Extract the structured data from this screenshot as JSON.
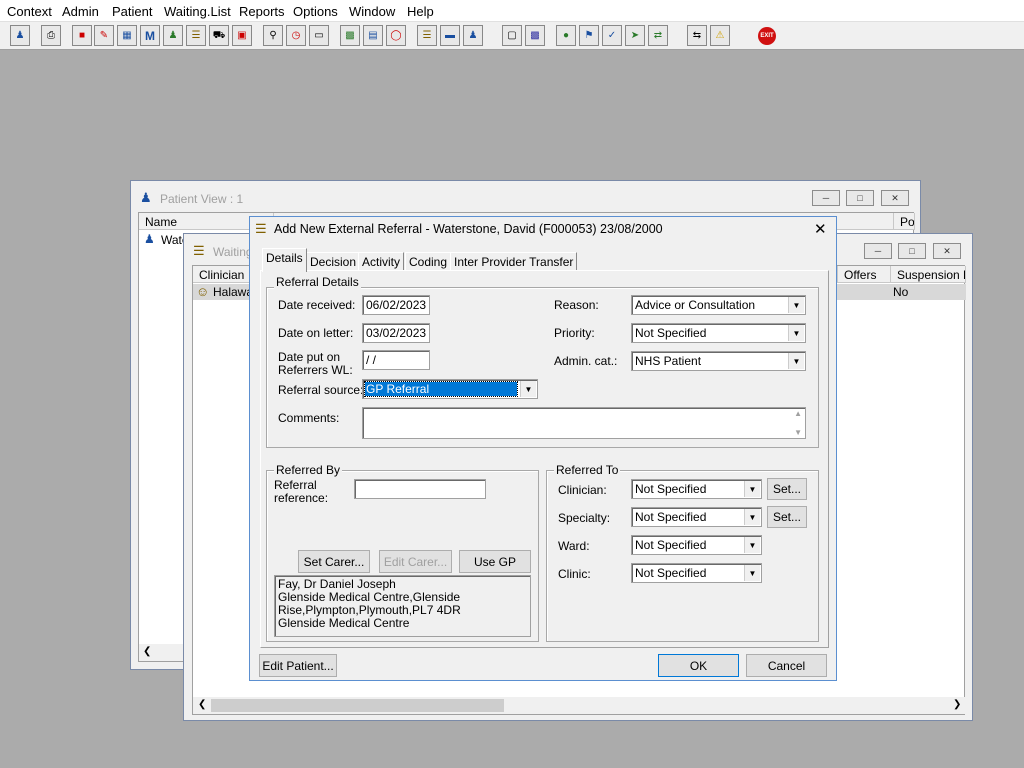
{
  "menu": [
    "Context",
    "Admin",
    "Patient",
    "Waiting.List",
    "Reports",
    "Options",
    "Window",
    "Help"
  ],
  "toolbar_icons": [
    "user-icon",
    "printer-icon",
    "book-red-icon",
    "book-edit-icon",
    "patient-card-icon",
    "m-icon",
    "doctor-icon",
    "notepad-icon",
    "ambulance-icon",
    "car-icon",
    "magnifier-icon",
    "clock-icon",
    "monitor-icon",
    "id-card-icon",
    "list-card-icon",
    "compass-icon",
    "notes-icon",
    "bed-icon",
    "nurse-icon",
    "document-icon",
    "bar-chart-icon",
    "globe-icon",
    "flag-icon",
    "check-card-icon",
    "green-arrow-card-icon",
    "green-arrows-card-icon",
    "swap-arrows-icon",
    "warning-icon",
    "exit-icon"
  ],
  "patient_view": {
    "title": "Patient View : 1",
    "col_name": "Name",
    "col_po": "Po",
    "row_name": "Wate"
  },
  "waiting": {
    "title": "Waiting",
    "col_clinician": "Clinician",
    "col_offers": "Offers",
    "col_suspension": "Suspension Pe",
    "row_clinician": "Halawa",
    "row_suspension": "No"
  },
  "dialog": {
    "title": "Add New External Referral - Waterstone, David (F000053) 23/08/2000",
    "tabs": [
      "Details",
      "Decision",
      "Activity",
      "Coding",
      "Inter Provider Transfer"
    ],
    "referral_details": {
      "label": "Referral Details",
      "date_received_label": "Date received:",
      "date_received": "06/02/2023",
      "date_letter_label": "Date on letter:",
      "date_letter": "03/02/2023",
      "date_wl_label1": "Date put on",
      "date_wl_label2": "Referrers WL:",
      "date_wl": " /  /",
      "source_label": "Referral source:",
      "source": "GP Referral",
      "reason_label": "Reason:",
      "reason": "Advice or Consultation",
      "priority_label": "Priority:",
      "priority": "Not Specified",
      "admin_label": "Admin. cat.:",
      "admin": "NHS Patient",
      "comments_label": "Comments:"
    },
    "referred_by": {
      "label": "Referred By",
      "ref_label1": "Referral",
      "ref_label2": "reference:",
      "set_carer": "Set Carer...",
      "edit_carer": "Edit Carer...",
      "use_gp": "Use GP",
      "gp_lines": [
        "Fay, Dr Daniel Joseph",
        "Glenside Medical Centre,Glenside",
        "Rise,Plympton,Plymouth,PL7 4DR",
        "Glenside Medical Centre"
      ]
    },
    "referred_to": {
      "label": "Referred To",
      "clinician_label": "Clinician:",
      "clinician": "Not Specified",
      "specialty_label": "Specialty:",
      "specialty": "Not Specified",
      "ward_label": "Ward:",
      "ward": "Not Specified",
      "clinic_label": "Clinic:",
      "clinic": "Not Specified",
      "set": "Set..."
    },
    "edit_patient": "Edit Patient...",
    "ok": "OK",
    "cancel": "Cancel"
  }
}
